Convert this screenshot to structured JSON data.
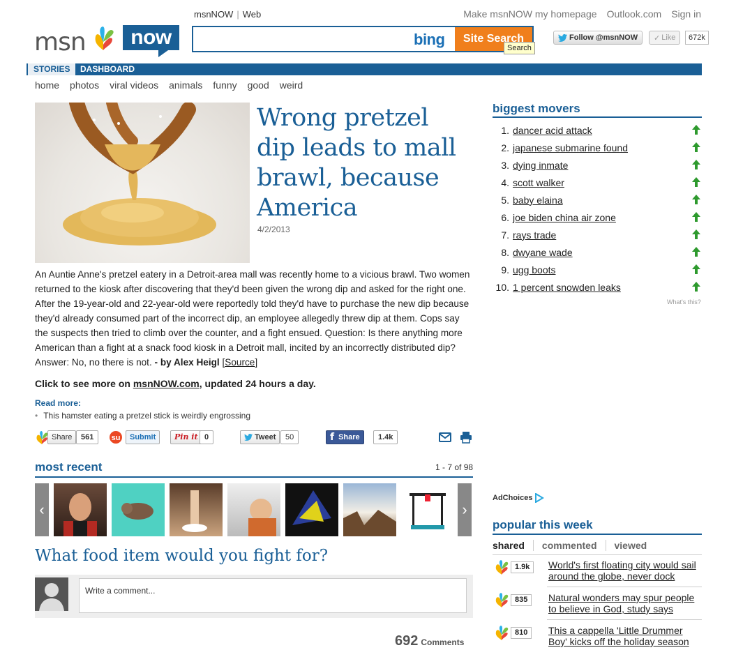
{
  "header": {
    "tab_msnnow": "msnNOW",
    "tab_sep": "|",
    "tab_web": "Web",
    "links": [
      "Make msnNOW my homepage",
      "Outlook.com",
      "Sign in"
    ],
    "logo_msn": "msn",
    "logo_now": "now",
    "search": {
      "placeholder": "",
      "bing": "bing",
      "button": "Site Search",
      "tooltip": "Search"
    },
    "twitter_label": "Follow @msnNOW",
    "like_label": "Like",
    "like_count": "672k"
  },
  "nav": {
    "stories": "STORIES",
    "dashboard": "DASHBOARD",
    "categories": [
      "home",
      "photos",
      "viral videos",
      "animals",
      "funny",
      "good",
      "weird"
    ]
  },
  "article": {
    "headline": "Wrong pretzel dip leads to mall brawl, because America",
    "date": "4/2/2013",
    "body": "An Auntie Anne's pretzel eatery in a Detroit-area mall was recently home to a vicious brawl. Two women returned to the kiosk after discovering that they'd been given the wrong dip and asked for the right one. After the 19-year-old and 22-year-old were reportedly told they'd have to purchase the new dip because they'd already consumed part of the incorrect dip, an employee allegedly threw dip at them. Cops say the suspects then tried to climb over the counter, and a fight ensued. Question: Is there anything more American than a fight at a snack food kiosk in a Detroit mall, incited by an incorrectly distributed dip? Answer: No, no there is not.",
    "byline_prefix": "- by Alex Heigl",
    "source": "[Source]",
    "cta_prefix": "Click to see more on ",
    "cta_link": "msnNOW.com",
    "cta_suffix": ", updated 24 hours a day.",
    "read_more_label": "Read more:",
    "read_more_item": "This hamster eating a pretzel stick is weirdly engrossing"
  },
  "share": {
    "msn_label": "Share",
    "msn_count": "561",
    "stumble_label": "Submit",
    "pinit_label": "Pin it",
    "pinit_count": "0",
    "tweet_label": "Tweet",
    "tweet_count": "50",
    "fb_label": "Share",
    "fb_count": "1.4k"
  },
  "most_recent": {
    "title": "most recent",
    "count": "1 - 7 of 98"
  },
  "comments": {
    "question": "What food item would you fight for?",
    "placeholder": "Write a comment...",
    "count": "692",
    "count_label": "Comments"
  },
  "biggest_movers": {
    "title": "biggest movers",
    "items": [
      {
        "num": "1.",
        "label": "dancer acid attack"
      },
      {
        "num": "2.",
        "label": "japanese submarine found"
      },
      {
        "num": "3.",
        "label": "dying inmate"
      },
      {
        "num": "4.",
        "label": "scott walker"
      },
      {
        "num": "5.",
        "label": "baby elaina"
      },
      {
        "num": "6.",
        "label": "joe biden china air zone"
      },
      {
        "num": "7.",
        "label": "rays trade"
      },
      {
        "num": "8.",
        "label": "dwyane wade"
      },
      {
        "num": "9.",
        "label": "ugg boots"
      },
      {
        "num": "10.",
        "label": "1 percent snowden leaks"
      }
    ],
    "whats_this": "What's this?"
  },
  "adchoices": "AdChoices",
  "popular": {
    "title": "popular this week",
    "tabs": [
      "shared",
      "commented",
      "viewed"
    ],
    "items": [
      {
        "count": "1.9k",
        "title": "World's first floating city would sail around the globe, never dock"
      },
      {
        "count": "835",
        "title": "Natural wonders may spur people to believe in God, study says"
      },
      {
        "count": "810",
        "title": "This a cappella 'Little Drummer Boy' kicks off the holiday season"
      }
    ]
  },
  "colors": {
    "brand_blue": "#1a5f96",
    "search_orange": "#f07f1c",
    "up_arrow": "#2e9a2e"
  }
}
